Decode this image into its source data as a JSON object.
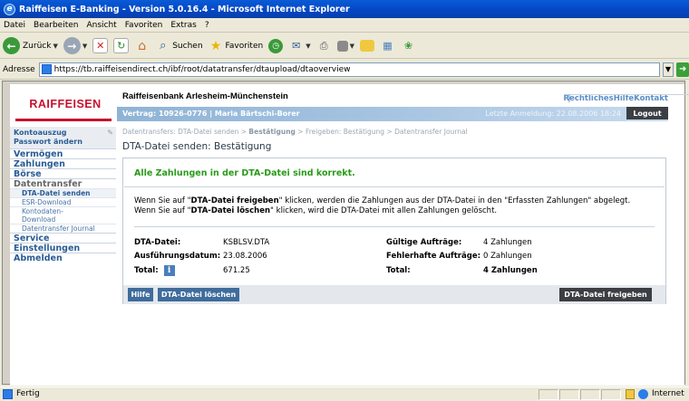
{
  "browser": {
    "title": "Raiffeisen E-Banking - Version 5.0.16.4 - Microsoft Internet Explorer",
    "menu": [
      "Datei",
      "Bearbeiten",
      "Ansicht",
      "Favoriten",
      "Extras",
      "?"
    ],
    "back_label": "Zurück",
    "search_label": "Suchen",
    "favorites_label": "Favoriten",
    "address_label": "Adresse",
    "url": "https://tb.raiffeisendirect.ch/ibf/root/datatransfer/dtaupload/dtaoverview",
    "status_text": "Fertig",
    "zone_text": "Internet"
  },
  "header": {
    "logo": "RAIFFEISEN",
    "bank_name": "Raiffeisenbank Arlesheim-Münchenstein",
    "links": [
      "Rechtliches",
      "Hilfe",
      "Kontakt"
    ],
    "contract": "Vertrag: 10926-0776 | Maria Bärtschi-Borer",
    "last_login": "Letzte Anmeldung: 22.08.2006 18:24",
    "logout": "Logout"
  },
  "sidebar": {
    "top_links": [
      "Kontoauszug",
      "Passwort ändern"
    ],
    "items": [
      {
        "label": "Vermögen"
      },
      {
        "label": "Zahlungen"
      },
      {
        "label": "Börse"
      },
      {
        "label": "Datentransfer"
      }
    ],
    "sub_items": [
      "DTA-Datei senden",
      "ESR-Download",
      "Kontodaten-",
      "Download",
      "Datentransfer Journal"
    ],
    "bottom_items": [
      "Service",
      "Einstellungen",
      "Abmelden"
    ]
  },
  "main": {
    "breadcrumb_pre": "Datentransfers: DTA-Datei senden > ",
    "breadcrumb_active": "Bestätigung",
    "breadcrumb_post": " > Freigeben: Bestätigung > Datentransfer Journal",
    "title": "DTA-Datei senden: Bestätigung",
    "success": "Alle Zahlungen in der DTA-Datei sind korrekt.",
    "info1_a": "Wenn Sie auf \"",
    "info1_b": "DTA-Datei freigeben",
    "info1_c": "\" klicken, werden die Zahlungen aus der DTA-Datei in den \"Erfassten Zahlungen\" abgelegt.",
    "info2_a": "Wenn Sie auf \"",
    "info2_b": "DTA-Datei löschen",
    "info2_c": "\" klicken, wird die DTA-Datei mit allen Zahlungen gelöscht.",
    "fields": {
      "file_label": "DTA-Datei:",
      "file_value": "KSBLSV.DTA",
      "date_label": "Ausführungsdatum:",
      "date_value": "23.08.2006",
      "total_label": "Total:",
      "total_value": "671.25",
      "valid_label": "Gültige Aufträge:",
      "valid_value": "4  Zahlungen",
      "error_label": "Fehlerhafte Aufträge:",
      "error_value": "0  Zahlungen",
      "total2_label": "Total:",
      "total2_value": "4 Zahlungen"
    },
    "buttons": {
      "help": "Hilfe",
      "delete": "DTA-Datei löschen",
      "release": "DTA-Datei freigeben"
    }
  },
  "colors": {
    "brand_red": "#c8102e",
    "nav_blue": "#2b5c94",
    "success_green": "#2a9a1a"
  }
}
